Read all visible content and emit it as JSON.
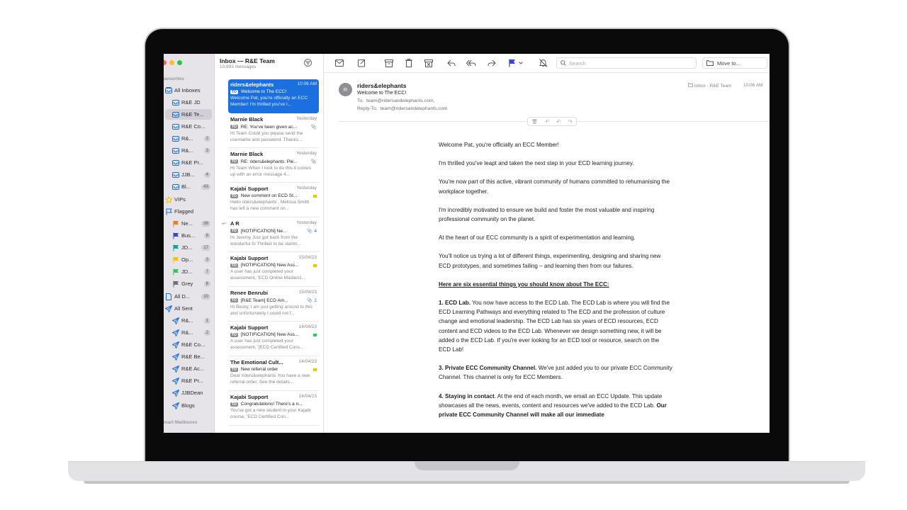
{
  "sidebar": {
    "section_favourites": "avourites",
    "section_smart": "mart Mailboxes",
    "items": [
      {
        "label": "All Inboxes",
        "badge": "",
        "icon": "inbox-stack-icon"
      },
      {
        "label": "R&E JD",
        "badge": "",
        "icon": "inbox-icon"
      },
      {
        "label": "R&E Te...",
        "badge": "",
        "icon": "inbox-icon"
      },
      {
        "label": "R&E Co...",
        "badge": "",
        "icon": "inbox-icon"
      },
      {
        "label": "R&...",
        "badge": "2",
        "icon": "inbox-icon"
      },
      {
        "label": "R&...",
        "badge": "3",
        "icon": "inbox-icon"
      },
      {
        "label": "R&E Pr...",
        "badge": "",
        "icon": "inbox-icon"
      },
      {
        "label": "JJB...",
        "badge": "4",
        "icon": "inbox-icon"
      },
      {
        "label": "Bl...",
        "badge": "43",
        "icon": "inbox-icon"
      },
      {
        "label": "VIPs",
        "badge": "",
        "icon": "star-icon"
      },
      {
        "label": "Flagged",
        "badge": "",
        "icon": "flag-icon"
      },
      {
        "label": "Ne...",
        "badge": "99",
        "icon": "flag-orange-icon"
      },
      {
        "label": "Bus...",
        "badge": "8",
        "icon": "flag-indigo-icon"
      },
      {
        "label": "JD...",
        "badge": "17",
        "icon": "flag-teal-icon"
      },
      {
        "label": "Op...",
        "badge": "3",
        "icon": "flag-yellow-icon"
      },
      {
        "label": "JD...",
        "badge": "7",
        "icon": "flag-green-icon"
      },
      {
        "label": "Grey",
        "badge": "8",
        "icon": "flag-grey-icon"
      },
      {
        "label": "All D...",
        "badge": "10",
        "icon": "document-icon"
      },
      {
        "label": "All Sent",
        "badge": "",
        "icon": "paper-plane-icon"
      },
      {
        "label": "R&...",
        "badge": "1",
        "icon": "paper-plane-icon"
      },
      {
        "label": "R&...",
        "badge": "2",
        "icon": "paper-plane-icon"
      },
      {
        "label": "R&E Co...",
        "badge": "",
        "icon": "paper-plane-icon"
      },
      {
        "label": "R&E Be...",
        "badge": "",
        "icon": "paper-plane-icon"
      },
      {
        "label": "R&E Ac...",
        "badge": "",
        "icon": "paper-plane-icon"
      },
      {
        "label": "R&E Pr...",
        "badge": "",
        "icon": "paper-plane-icon"
      },
      {
        "label": "JJBDean",
        "badge": "",
        "icon": "paper-plane-icon"
      },
      {
        "label": "Blogs",
        "badge": "",
        "icon": "paper-plane-icon"
      }
    ]
  },
  "message_list": {
    "title": "Inbox — R&E Team",
    "count": "10,993 messages",
    "messages": [
      {
        "sender": "riders&elephants",
        "date": "10:06 AM",
        "subject": "Welcome to The ECC!",
        "preview": "Welcome Pat, you're officially an ECC Member! I'm thrilled you've l...",
        "marker": ""
      },
      {
        "sender": "Marnie Black",
        "date": "Yesterday",
        "subject": "RE: You've been given ac...",
        "preview": "Hi Team Could you please send the username and password. Thanks...",
        "marker": "📎"
      },
      {
        "sender": "Marnie Black",
        "date": "Yesterday",
        "subject": "RE: riders&elephants: Ple...",
        "preview": "Hi Team When I look to do this it comes up with an error message 4...",
        "marker": "📎"
      },
      {
        "sender": "Kajabi Support",
        "date": "Yesterday",
        "subject": "New comment on ECD St...",
        "preview": "Hello riders&elephants , Melissa Smith has left a new comment on...",
        "marker": "flag-yellow"
      },
      {
        "sender": "A R",
        "date": "Yesterday",
        "subject": "[NOTIFICATION] Ne...",
        "preview": "Hi Jeremy Just got back from the wonderful Si Thrilled to be startin...",
        "marker": "4"
      },
      {
        "sender": "Kajabi Support",
        "date": "15/04/23",
        "subject": "[NOTIFICATION] New Ass...",
        "preview": "A user has just completed your assessment, 'ECD Online Mastercl...",
        "marker": "flag-yellow"
      },
      {
        "sender": "Renee Benrubi",
        "date": "15/04/23",
        "subject": "[R&E Team] ECD Am...",
        "preview": "Hi Becky, I am just getting around to this and unfortunately I could not f...",
        "marker": "2"
      },
      {
        "sender": "Kajabi Support",
        "date": "14/04/23",
        "subject": "[NOTIFICATION] New Ass...",
        "preview": "A user has just completed your assessment, '[ECD Certified Cons...",
        "marker": "flag-green"
      },
      {
        "sender": "The Emotional Cult...",
        "date": "14/04/23",
        "subject": "New referral order",
        "preview": "Dear riders&elephants You have a new referral order. See the details...",
        "marker": "flag-yellow"
      },
      {
        "sender": "Kajabi Support",
        "date": "14/04/23",
        "subject": "Congratulations! There's a n...",
        "preview": "You've got a new student in your Kajabi course, 'ECD Certified Con...",
        "marker": ""
      }
    ],
    "to_tag": "TO"
  },
  "toolbar": {
    "search_placeholder": "Search",
    "move_to": "Move to..."
  },
  "reader": {
    "avatar_initial": "R",
    "from": "riders&elephants",
    "subject": "Welcome to The ECC!",
    "to_label": "To:",
    "to_value": "team@ridersandelephants.com,",
    "reply_label": "Reply-To:",
    "reply_value": "team@ridersandelephants.com",
    "folder": "Inbox - R&E Team",
    "time": "10:06 AM",
    "body": {
      "p1": "Welcome Pat, you're officially an ECC Member!",
      "p2": "I'm thrilled you've leapt and taken the next step in your ECD learning journey.",
      "p3": "You're now part of this active, vibrant community of humans committed to rehumanising the workplace together.",
      "p4": "I'm incredibly motivated to ensure we build and foster the most valuable and inspiring professional community on the planet.",
      "p5": "At the heart of our ECC community is a spirit of experimentation and learning.",
      "p6": "You'll notice us trying a lot of different things, experimenting, designing and sharing new ECD prototypes, and sometimes failing – and learning then from our failures.",
      "heading": "Here are six essential things you should know about The ECC:",
      "item1_title": "1. ECD Lab.",
      "item1_text": " You now have access to the ECD Lab. The ECD Lab is where you will find the ECD Learning Pathways and everything related to The ECD and the profession of culture change and emotional leadership. The ECD Lab has six years of ECD resources, ECD content and ECD videos to the ECD Lab. Whenever we design something new, it will be added o the ECD Lab. If you're ever looking for an ECD tool or resource, search on the ECD Lab!",
      "item3_title": "3. Private ECC Community Channel.",
      "item3_text": " We've just added you to our private ECC Community Channel. This channel is only for ECC Members.",
      "item4_title": "4. Staying in contact",
      "item4_text": ". At the end of each month, we email an ECC Update. This update showcases all the news, events, content and resources we've added to the ECD Lab. ",
      "item4_bold": "Our private ECC Community Channel will make all our immediate"
    }
  },
  "colors": {
    "accent": "#1b6fde",
    "sidebar_bg": "#e6e4e8",
    "flag_yellow": "#f5c400",
    "flag_green": "#34c759"
  }
}
